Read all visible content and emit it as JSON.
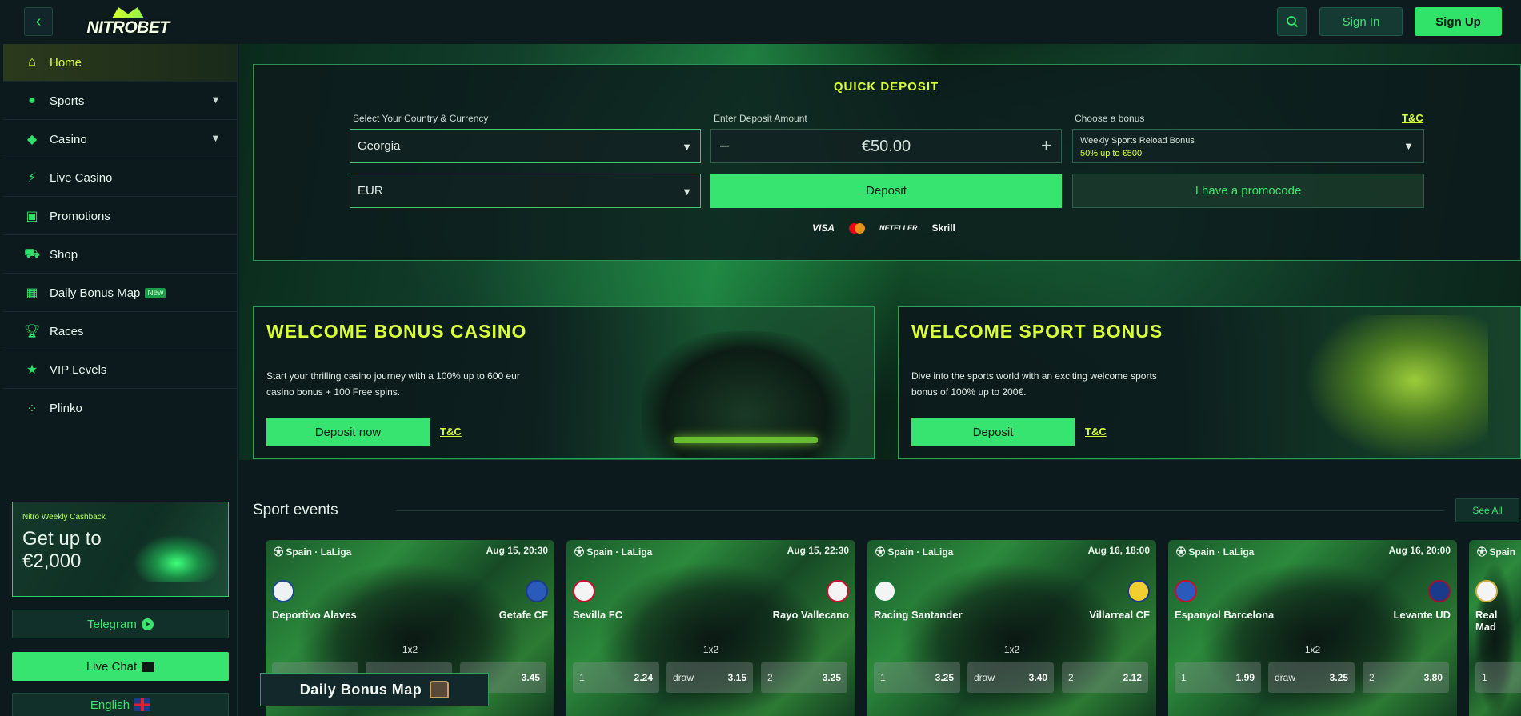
{
  "header": {
    "logo_text": "NITROBET",
    "signin_label": "Sign In",
    "signup_label": "Sign Up"
  },
  "sidebar": {
    "items": [
      {
        "label": "Home",
        "icon": "home-icon"
      },
      {
        "label": "Sports",
        "icon": "basketball-icon"
      },
      {
        "label": "Casino",
        "icon": "gamepad-icon"
      },
      {
        "label": "Live Casino",
        "icon": "lightning-icon"
      },
      {
        "label": "Promotions",
        "icon": "gift-icon"
      },
      {
        "label": "Shop",
        "icon": "cart-icon"
      },
      {
        "label": "Daily Bonus Map",
        "icon": "calendar-icon",
        "badge": "New"
      },
      {
        "label": "Races",
        "icon": "trophy-icon"
      },
      {
        "label": "VIP Levels",
        "icon": "star-icon"
      },
      {
        "label": "Plinko",
        "icon": "plinko-icon"
      }
    ],
    "cashback": {
      "title": "Nitro Weekly Cashback",
      "text": "Get up to €2,000"
    },
    "telegram_label": "Telegram",
    "livechat_label": "Live Chat",
    "language_label": "English"
  },
  "quick_deposit": {
    "title": "QUICK DEPOSIT",
    "country_label": "Select Your Country & Currency",
    "country_value": "Georgia",
    "currency_value": "EUR",
    "amount_label": "Enter Deposit Amount",
    "amount_value": "€50.00",
    "deposit_label": "Deposit",
    "bonus_label": "Choose a bonus",
    "tc_label": "T&C",
    "bonus_name": "Weekly Sports Reload Bonus",
    "bonus_detail": "50% up to €500",
    "promo_label": "I have a promocode",
    "payments": [
      "VISA",
      "NETELLER",
      "Skrill"
    ]
  },
  "bonuses": [
    {
      "title": "WELCOME BONUS CASINO",
      "desc": "Start your thrilling casino journey with a 100% up to 600 eur casino bonus + 100 Free spins.",
      "button": "Deposit now",
      "tc": "T&C"
    },
    {
      "title": "WELCOME SPORT BONUS",
      "desc": "Dive into the sports world with an exciting welcome sports bonus of 100% up to 200€.",
      "button": "Deposit",
      "tc": "T&C"
    }
  ],
  "sport_events": {
    "title": "Sport events",
    "see_all": "See All",
    "events": [
      {
        "league": "Spain · LaLiga",
        "date": "Aug 15, 20:30",
        "home": "Deportivo Alaves",
        "away": "Getafe CF",
        "market": "1x2",
        "odds": [
          {
            "label": "",
            "value": ""
          },
          {
            "label": "",
            "value": ""
          },
          {
            "label": "",
            "value": "3.45"
          }
        ]
      },
      {
        "league": "Spain · LaLiga",
        "date": "Aug 15, 22:30",
        "home": "Sevilla FC",
        "away": "Rayo Vallecano",
        "market": "1x2",
        "odds": [
          {
            "label": "1",
            "value": "2.24"
          },
          {
            "label": "draw",
            "value": "3.15"
          },
          {
            "label": "2",
            "value": "3.25"
          }
        ]
      },
      {
        "league": "Spain · LaLiga",
        "date": "Aug 16, 18:00",
        "home": "Racing Santander",
        "away": "Villarreal CF",
        "market": "1x2",
        "odds": [
          {
            "label": "1",
            "value": "3.25"
          },
          {
            "label": "draw",
            "value": "3.40"
          },
          {
            "label": "2",
            "value": "2.12"
          }
        ]
      },
      {
        "league": "Spain · LaLiga",
        "date": "Aug 16, 20:00",
        "home": "Espanyol Barcelona",
        "away": "Levante UD",
        "market": "1x2",
        "odds": [
          {
            "label": "1",
            "value": "1.99"
          },
          {
            "label": "draw",
            "value": "3.25"
          },
          {
            "label": "2",
            "value": "3.80"
          }
        ]
      },
      {
        "league": "Spain",
        "date": "",
        "home": "Real Mad",
        "away": "",
        "market": "",
        "odds": [
          {
            "label": "1",
            "value": ""
          }
        ]
      }
    ]
  },
  "daily_bonus_map_label": "Daily Bonus Map",
  "colors": {
    "accent": "#36e46f",
    "highlight": "#d8ff3a",
    "background": "#0c1a1d"
  }
}
